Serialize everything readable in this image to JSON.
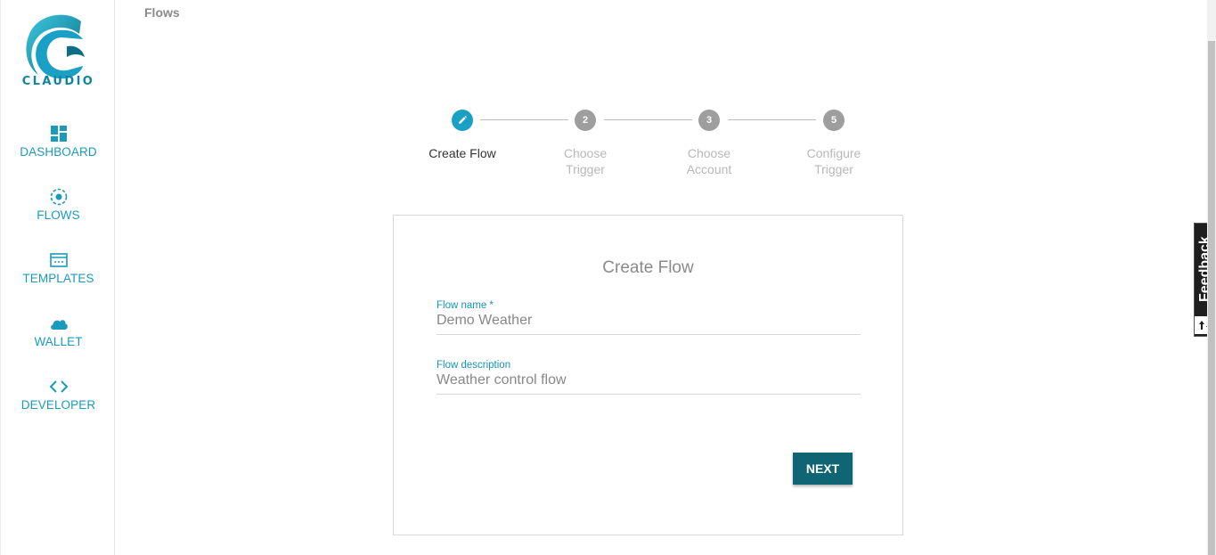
{
  "app": {
    "logo_text": "CLAUDIO",
    "brand_color": "#1aa0c4"
  },
  "sidebar": {
    "items": [
      {
        "label": "DASHBOARD",
        "icon": "dashboard-icon"
      },
      {
        "label": "FLOWS",
        "icon": "flows-icon"
      },
      {
        "label": "TEMPLATES",
        "icon": "templates-icon"
      },
      {
        "label": "WALLET",
        "icon": "cloud-icon"
      },
      {
        "label": "DEVELOPER",
        "icon": "code-icon"
      }
    ]
  },
  "header": {
    "breadcrumb": "Flows"
  },
  "stepper": {
    "steps": [
      {
        "label": "Create Flow",
        "number": "",
        "state": "active",
        "icon": "pencil-icon"
      },
      {
        "label": "Choose Trigger",
        "number": "2",
        "state": "inactive"
      },
      {
        "label": "Choose Account",
        "number": "3",
        "state": "inactive"
      },
      {
        "label": "Configure Trigger",
        "number": "5",
        "state": "inactive"
      }
    ]
  },
  "form": {
    "title": "Create Flow",
    "flow_name_label": "Flow name *",
    "flow_name_value": "Demo Weather",
    "flow_description_label": "Flow description",
    "flow_description_value": "Weather control flow",
    "next_label": "NEXT"
  },
  "feedback": {
    "label": "Feedback",
    "icon": "sort-arrows-icon"
  }
}
